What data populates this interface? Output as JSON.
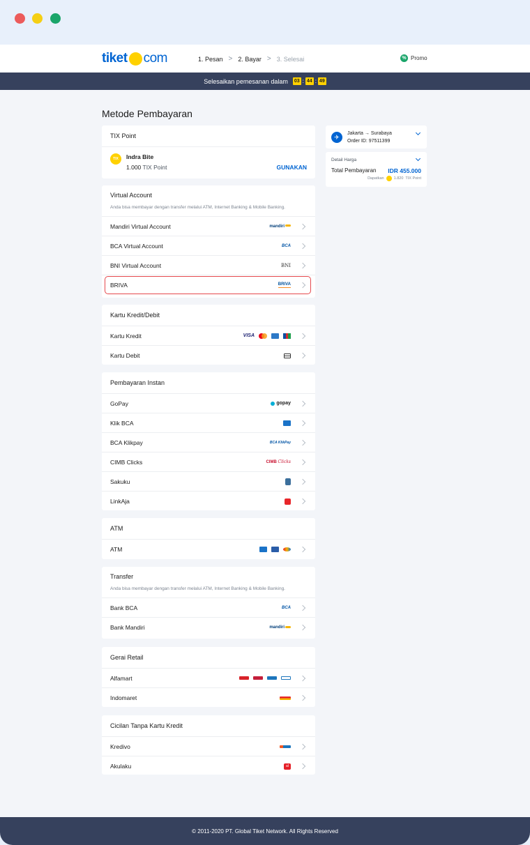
{
  "header": {
    "logo_left": "tiket",
    "logo_right": "com",
    "steps": [
      "1. Pesan",
      "2. Bayar",
      "3. Selesai"
    ],
    "promo_label": "Promo"
  },
  "timer": {
    "label": "Selesaikan pemesanan dalam",
    "hours": "03",
    "minutes": "44",
    "seconds": "49"
  },
  "page_title": "Metode Pembayaran",
  "tix": {
    "title": "TIX Point",
    "badge": "TIX",
    "name": "Indra Bite",
    "points": "1.000",
    "points_unit": "TIX Point",
    "action": "GUNAKAN"
  },
  "virtual_account": {
    "title": "Virtual Account",
    "desc": "Anda bisa membayar dengan transfer melalui ATM, Internet Banking & Mobile Banking.",
    "items": [
      {
        "label": "Mandiri Virtual Account",
        "logo": "mandiri"
      },
      {
        "label": "BCA Virtual Account",
        "logo": "BCA"
      },
      {
        "label": "BNI Virtual Account",
        "logo": "BNI"
      },
      {
        "label": "BRIVA",
        "logo": "BRIVA"
      }
    ]
  },
  "credit": {
    "title": "Kartu Kredit/Debit",
    "items": [
      {
        "label": "Kartu Kredit",
        "logo": "VISA"
      },
      {
        "label": "Kartu Debit"
      }
    ]
  },
  "instant": {
    "title": "Pembayaran Instan",
    "items": [
      {
        "label": "GoPay",
        "logo": "gopay"
      },
      {
        "label": "Klik BCA"
      },
      {
        "label": "BCA Klikpay",
        "logo": "BCA KlikPay"
      },
      {
        "label": "CIMB Clicks",
        "logo": "CIMB",
        "logo2": "Clicks"
      },
      {
        "label": "Sakuku"
      },
      {
        "label": "LinkAja"
      }
    ]
  },
  "atm": {
    "title": "ATM",
    "items": [
      {
        "label": "ATM"
      }
    ]
  },
  "transfer": {
    "title": "Transfer",
    "desc": "Anda bisa membayar dengan transfer melalui ATM, Internet Banking & Mobile Banking.",
    "items": [
      {
        "label": "Bank BCA",
        "logo": "BCA"
      },
      {
        "label": "Bank Mandiri",
        "logo": "mandiri"
      }
    ]
  },
  "retail": {
    "title": "Gerai Retail",
    "items": [
      {
        "label": "Alfamart"
      },
      {
        "label": "Indomaret"
      }
    ]
  },
  "cicilan": {
    "title": "Cicilan Tanpa Kartu Kredit",
    "items": [
      {
        "label": "Kredivo"
      },
      {
        "label": "Akulaku",
        "logo": "al"
      }
    ]
  },
  "summary": {
    "origin": "Jakarta",
    "destination": "Surabaya",
    "order_id": "Order ID: 97511399",
    "detail_label": "Detail Harga",
    "total_label": "Total Pembayaran",
    "total_value": "IDR 455.000",
    "earn_prefix": "Dapatkan",
    "earn_points": "1.820",
    "earn_unit": "TIX Point"
  },
  "footer": "© 2011-2020 PT. Global Tiket Network. All Rights Reserved",
  "colors": {
    "brand_blue": "#0064d2",
    "brand_yellow": "#ffd100",
    "navy": "#36415d",
    "selected_border": "#e5484d"
  }
}
